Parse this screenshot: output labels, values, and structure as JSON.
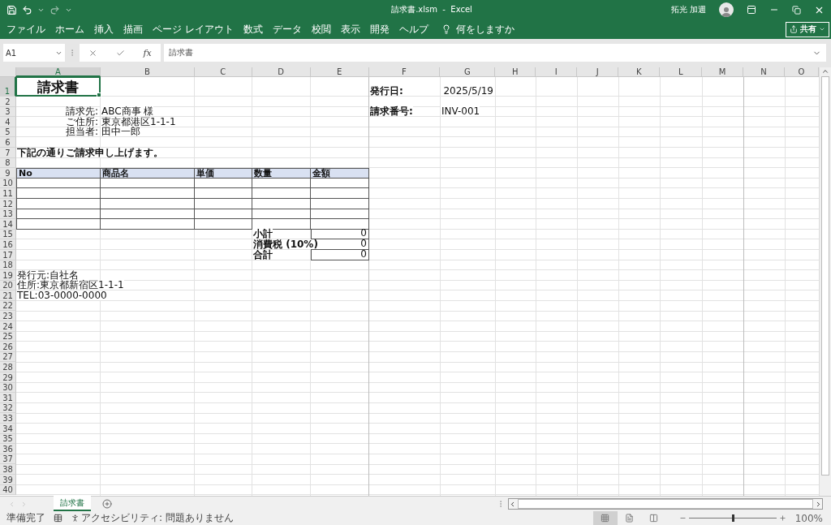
{
  "title_bar": {
    "title": "請求書.xlsm  -  Excel",
    "user": "拓光 加週"
  },
  "ribbon_tabs": [
    {
      "label": "ファイル",
      "selected": false
    },
    {
      "label": "ホーム",
      "selected": false
    },
    {
      "label": "挿入",
      "selected": false
    },
    {
      "label": "描画",
      "selected": false
    },
    {
      "label": "ページ レイアウト",
      "selected": false
    },
    {
      "label": "数式",
      "selected": false
    },
    {
      "label": "データ",
      "selected": false
    },
    {
      "label": "校閲",
      "selected": false
    },
    {
      "label": "表示",
      "selected": false
    },
    {
      "label": "開発",
      "selected": false
    },
    {
      "label": "ヘルプ",
      "selected": false
    }
  ],
  "tell_me": "何をしますか",
  "share_button": "共有",
  "formula_bar": {
    "name_box": "A1",
    "fx_label": "fx",
    "formula": "請求書"
  },
  "columns": [
    {
      "label": "A",
      "selected": true
    },
    {
      "label": "B",
      "selected": false
    },
    {
      "label": "C",
      "selected": false
    },
    {
      "label": "D",
      "selected": false
    },
    {
      "label": "E",
      "selected": false
    },
    {
      "label": "F",
      "selected": false
    },
    {
      "label": "G",
      "selected": false
    },
    {
      "label": "H",
      "selected": false
    },
    {
      "label": "I",
      "selected": false
    },
    {
      "label": "J",
      "selected": false
    },
    {
      "label": "K",
      "selected": false
    },
    {
      "label": "L",
      "selected": false
    },
    {
      "label": "M",
      "selected": false
    },
    {
      "label": "N",
      "selected": false
    },
    {
      "label": "O",
      "selected": false
    }
  ],
  "rows": [
    {
      "number": "1",
      "selected": true,
      "cells": {
        "A": {
          "text": "請求書",
          "kind": "title",
          "selected": true
        },
        "F": {
          "text": "発行日:",
          "kind": "bold"
        },
        "G": {
          "text": "2025/5/19",
          "kind": "number"
        }
      }
    },
    {
      "number": "2",
      "selected": false
    },
    {
      "number": "3",
      "selected": false,
      "cells": {
        "A": {
          "text": "請求先:",
          "kind": "label_right"
        },
        "B": {
          "text": "ABC商事 様",
          "kind": "text"
        },
        "F": {
          "text": "請求番号:",
          "kind": "bold"
        },
        "G": {
          "text": "INV-001",
          "kind": "text"
        }
      }
    },
    {
      "number": "4",
      "selected": false,
      "cells": {
        "A": {
          "text": "ご住所:",
          "kind": "label_right"
        },
        "B": {
          "text": "東京都港区1-1-1",
          "kind": "text"
        }
      }
    },
    {
      "number": "5",
      "selected": false,
      "cells": {
        "A": {
          "text": "担当者:",
          "kind": "label_right"
        },
        "B": {
          "text": "田中一郎",
          "kind": "text"
        }
      }
    },
    {
      "number": "6",
      "selected": false
    },
    {
      "number": "7",
      "selected": false,
      "cells": {
        "A": {
          "text": "下記の通りご請求申し上げます。",
          "kind": "bold"
        }
      }
    },
    {
      "number": "8",
      "selected": false
    },
    {
      "number": "9",
      "selected": false,
      "cells": {
        "A": {
          "text": "No",
          "kind": "header"
        },
        "B": {
          "text": "商品名",
          "kind": "header"
        },
        "C": {
          "text": "単価",
          "kind": "header"
        },
        "D": {
          "text": "数量",
          "kind": "header"
        },
        "E": {
          "text": "金額",
          "kind": "header"
        }
      }
    },
    {
      "number": "10",
      "selected": false,
      "cells": {
        "A": {
          "kind": "grid"
        },
        "B": {
          "kind": "grid"
        },
        "C": {
          "kind": "grid"
        },
        "D": {
          "kind": "grid"
        },
        "E": {
          "kind": "grid"
        }
      }
    },
    {
      "number": "11",
      "selected": false,
      "cells": {
        "A": {
          "kind": "grid"
        },
        "B": {
          "kind": "grid"
        },
        "C": {
          "kind": "grid"
        },
        "D": {
          "kind": "grid"
        },
        "E": {
          "kind": "grid"
        }
      }
    },
    {
      "number": "12",
      "selected": false,
      "cells": {
        "A": {
          "kind": "grid"
        },
        "B": {
          "kind": "grid"
        },
        "C": {
          "kind": "grid"
        },
        "D": {
          "kind": "grid"
        },
        "E": {
          "kind": "grid"
        }
      }
    },
    {
      "number": "13",
      "selected": false,
      "cells": {
        "A": {
          "kind": "grid"
        },
        "B": {
          "kind": "grid"
        },
        "C": {
          "kind": "grid"
        },
        "D": {
          "kind": "grid"
        },
        "E": {
          "kind": "grid"
        }
      }
    },
    {
      "number": "14",
      "selected": false,
      "cells": {
        "A": {
          "kind": "grid"
        },
        "B": {
          "kind": "grid"
        },
        "C": {
          "kind": "grid"
        },
        "D": {
          "kind": "grid"
        },
        "E": {
          "kind": "grid"
        }
      }
    },
    {
      "number": "15",
      "selected": false,
      "cells": {
        "D": {
          "text": "小計",
          "kind": "bold"
        },
        "E": {
          "text": "0",
          "kind": "total"
        }
      }
    },
    {
      "number": "16",
      "selected": false,
      "cells": {
        "D": {
          "text": "消費税 (10%)",
          "kind": "bold"
        },
        "E": {
          "text": "0",
          "kind": "total"
        }
      }
    },
    {
      "number": "17",
      "selected": false,
      "cells": {
        "D": {
          "text": "合計",
          "kind": "bold"
        },
        "E": {
          "text": "0",
          "kind": "total"
        }
      }
    },
    {
      "number": "18",
      "selected": false
    },
    {
      "number": "19",
      "selected": false,
      "cells": {
        "A": {
          "text": "発行元:自社名",
          "kind": "text"
        }
      }
    },
    {
      "number": "20",
      "selected": false,
      "cells": {
        "A": {
          "text": "住所:東京都新宿区1-1-1",
          "kind": "text"
        }
      }
    },
    {
      "number": "21",
      "selected": false,
      "cells": {
        "A": {
          "text": "TEL:03-0000-0000",
          "kind": "text"
        }
      }
    },
    {
      "number": "22",
      "selected": false
    },
    {
      "number": "23",
      "selected": false
    },
    {
      "number": "24",
      "selected": false
    },
    {
      "number": "25",
      "selected": false
    },
    {
      "number": "26",
      "selected": false
    },
    {
      "number": "27",
      "selected": false
    },
    {
      "number": "28",
      "selected": false
    },
    {
      "number": "29",
      "selected": false
    },
    {
      "number": "30",
      "selected": false
    },
    {
      "number": "31",
      "selected": false
    },
    {
      "number": "32",
      "selected": false
    },
    {
      "number": "33",
      "selected": false
    },
    {
      "number": "34",
      "selected": false
    },
    {
      "number": "35",
      "selected": false
    },
    {
      "number": "36",
      "selected": false
    },
    {
      "number": "37",
      "selected": false
    },
    {
      "number": "38",
      "selected": false
    },
    {
      "number": "39",
      "selected": false
    },
    {
      "number": "40",
      "selected": false
    }
  ],
  "sheet_tabs": [
    {
      "label": "請求書",
      "selected": true
    }
  ],
  "status_bar": {
    "status": "準備完了",
    "accessibility": "アクセシビリティ: 問題ありません",
    "views": [
      {
        "kind": "normal",
        "selected": true
      },
      {
        "kind": "page_layout",
        "selected": false
      },
      {
        "kind": "page_break",
        "selected": false
      }
    ],
    "zoom": {
      "level": 0.5,
      "reading": "100%"
    }
  }
}
